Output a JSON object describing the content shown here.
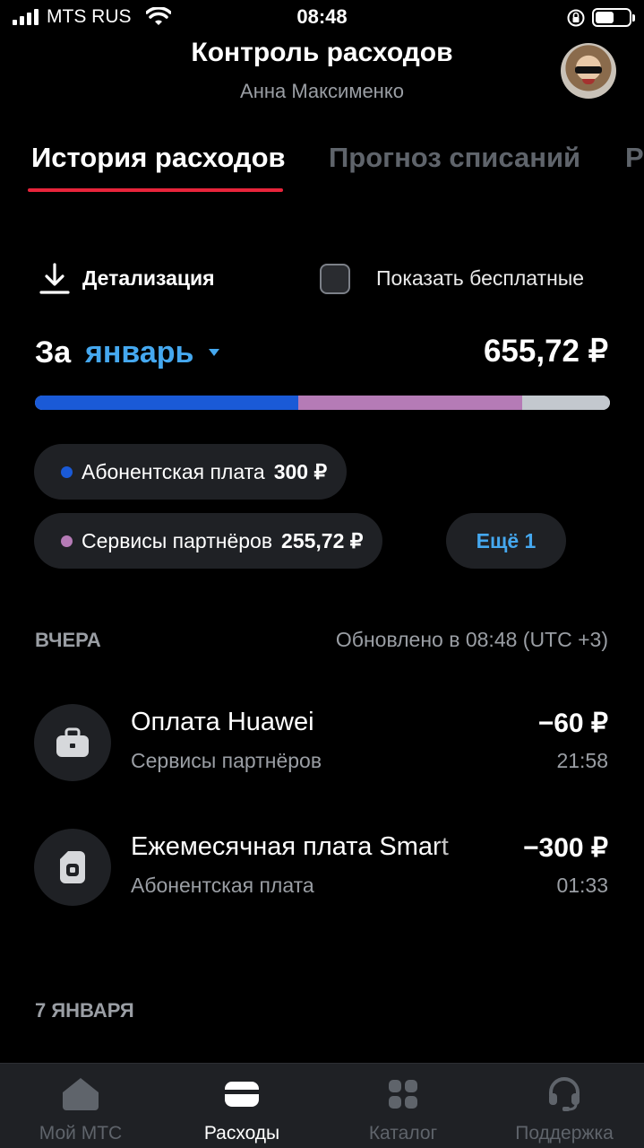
{
  "status_bar": {
    "carrier": "MTS RUS",
    "time": "08:48",
    "battery_level": 0.55
  },
  "header": {
    "title": "Контроль расходов",
    "subtitle": "Анна Максименко"
  },
  "tabs": [
    {
      "label": "История расходов",
      "active": true
    },
    {
      "label": "Прогноз списаний",
      "active": false
    },
    {
      "label": "Р",
      "active": false
    }
  ],
  "actions": {
    "detail_label": "Детализация",
    "show_free_label": "Показать бесплатные",
    "show_free_checked": false
  },
  "period": {
    "prefix": "За",
    "month": "январь",
    "total": "655,72 ₽"
  },
  "breakdown": {
    "segments": [
      {
        "name": "Абонентская плата",
        "value": 300,
        "color": "#1a5ad7"
      },
      {
        "name": "Сервисы партнёров",
        "value": 255.72,
        "color": "#b57bb6"
      },
      {
        "name": "other",
        "value": 100,
        "color": "#c3c8ce"
      }
    ],
    "chips": [
      {
        "label": "Абонентская плата",
        "amount": "300 ₽",
        "color": "#1a5ad7"
      },
      {
        "label": "Сервисы партнёров",
        "amount": "255,72 ₽",
        "color": "#b57bb6"
      }
    ],
    "more_label": "Ещё 1"
  },
  "sections": [
    {
      "label": "ВЧЕРА",
      "updated": "Обновлено в 08:48 (UTC +3)",
      "transactions": [
        {
          "title": "Оплата Huawei",
          "category": "Сервисы партнёров",
          "amount": "−60 ₽",
          "time": "21:58",
          "icon": "briefcase-icon"
        },
        {
          "title": "Ежемесячная плата Smart",
          "category": "Абонентская плата",
          "amount": "−300 ₽",
          "time": "01:33",
          "icon": "sim-icon"
        }
      ]
    },
    {
      "label": "7 ЯНВАРЯ"
    }
  ],
  "bottom_nav": [
    {
      "label": "Мой МТС",
      "icon": "home-icon",
      "active": false
    },
    {
      "label": "Расходы",
      "icon": "wallet-icon",
      "active": true
    },
    {
      "label": "Каталог",
      "icon": "grid-icon",
      "active": false
    },
    {
      "label": "Поддержка",
      "icon": "headset-icon",
      "active": false
    }
  ]
}
